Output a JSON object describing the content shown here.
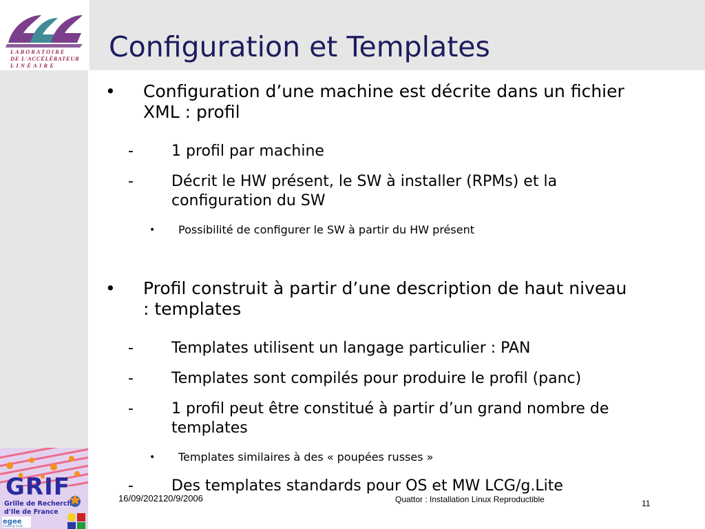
{
  "slide": {
    "title": "Configuration et Templates",
    "title_color": "#1c1c5e",
    "background_color": "#ffffff",
    "band_color": "#e6e6e6"
  },
  "logos": {
    "top_left": {
      "name": "lal-logo",
      "line1": "L A B O R A T O I R E",
      "line2": "DE L'ACCÉLÉRATEUR",
      "line3": "L I N É A I R E",
      "mark_text": "LAL",
      "color_purple": "#7b3f8c",
      "color_teal": "#3f8c96",
      "color_text": "#9b2a4a"
    },
    "bottom_left": {
      "name": "grif-logo",
      "title": "GRIF",
      "line1": "Grille de Recherche",
      "line2": "d'Ile de France",
      "egee_text": "egee",
      "egee_sub1": "Enabling Grids",
      "egee_sub2": "for E-sciencE",
      "color_bg": "#e2d2f0",
      "color_title": "#2a2a9e",
      "color_stripe": "#f06a8a",
      "color_star": "#f08a2a"
    }
  },
  "bullets": [
    {
      "level": 1,
      "marker": "•",
      "text": "Configuration d’une  machine est décrite dans un fichier XML : profil"
    },
    {
      "level": 2,
      "marker": "-",
      "text": "1 profil par machine"
    },
    {
      "level": 2,
      "marker": "-",
      "text": "Décrit le HW présent, le SW à installer (RPMs) et la configuration du SW"
    },
    {
      "level": 3,
      "marker": "•",
      "text": "Possibilité de configurer le SW à partir du HW présent"
    },
    {
      "level": 1,
      "marker": "•",
      "text": "Profil construit à partir d’une description de haut niveau : templates"
    },
    {
      "level": 2,
      "marker": "-",
      "text": "Templates utilisent un langage particulier : PAN"
    },
    {
      "level": 2,
      "marker": "-",
      "text": "Templates sont compilés pour produire le profil (panc)"
    },
    {
      "level": 2,
      "marker": "-",
      "text": "1 profil peut être constitué à partir d’un grand nombre de templates"
    },
    {
      "level": 3,
      "marker": "•",
      "text": "Templates similaires à des « poupées russes »"
    },
    {
      "level": 2,
      "marker": "-",
      "text": "Des templates standards pour OS et MW LCG/g.Lite"
    }
  ],
  "footer": {
    "date": "16/09/202120/9/2006",
    "center": "Quattor : Installation Linux Reproductible",
    "page_number": "11"
  }
}
